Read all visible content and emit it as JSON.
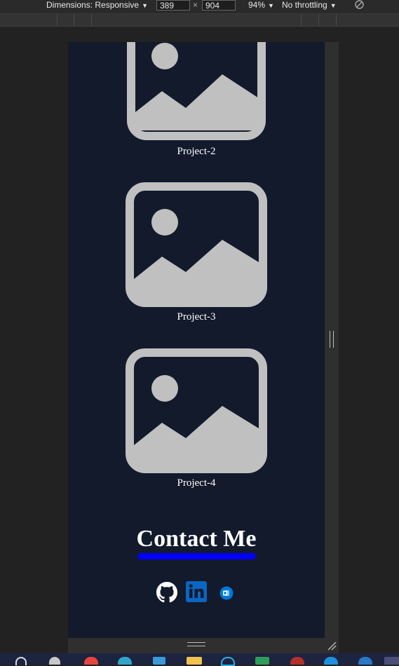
{
  "devtools": {
    "dimensions_label": "Dimensions: Responsive",
    "width": "389",
    "height": "904",
    "times": "×",
    "zoom": "94%",
    "throttling": "No throttling"
  },
  "projects": [
    {
      "label": "Project-2"
    },
    {
      "label": "Project-3"
    },
    {
      "label": "Project-4"
    }
  ],
  "contact": {
    "title": "Contact Me"
  },
  "colors": {
    "page_bg": "#121a2c",
    "underline": "#0000ff",
    "placeholder": "#c0c0c0",
    "linkedin": "#0a66c2",
    "outlook": "#0078d4"
  },
  "icons": [
    "github-icon",
    "linkedin-icon",
    "outlook-icon"
  ]
}
